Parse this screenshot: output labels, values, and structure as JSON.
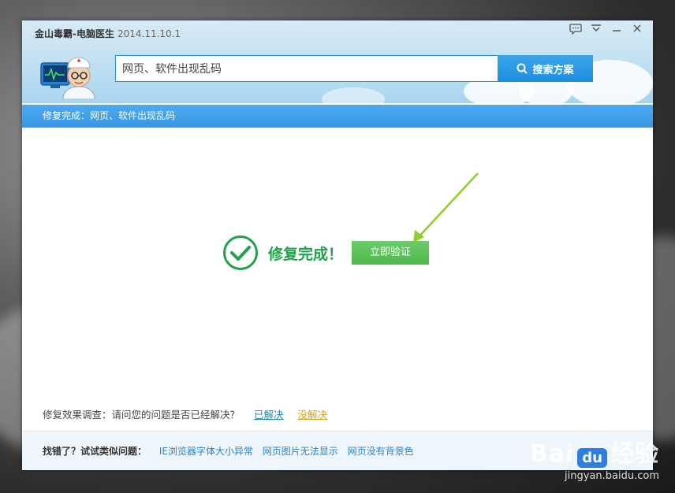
{
  "window": {
    "title": "金山毒霸-电脑医生",
    "version": "2014.11.10.1"
  },
  "search": {
    "value": "网页、软件出现乱码",
    "button_label": "搜索方案"
  },
  "breadcrumb": {
    "text": "修复完成：网页、软件出现乱码"
  },
  "main": {
    "status_text": "修复完成！",
    "verify_button_label": "立即验证"
  },
  "survey": {
    "question": "修复效果调查：请问您的问题是否已经解决？",
    "solved_label": "已解决",
    "unsolved_label": "没解决"
  },
  "footer": {
    "label": "找错了？试试类似问题：",
    "links": [
      "IE浏览器字体大小异常",
      "网页图片无法显示",
      "网页没有背景色"
    ]
  },
  "watermark": {
    "brand_left": "Bai",
    "brand_du": "du",
    "brand_right": "经验",
    "url": "jingyan.baidu.com"
  },
  "colors": {
    "accent_blue": "#3796e4",
    "success_green": "#1fa24a",
    "verify_button": "#5cc05a"
  }
}
